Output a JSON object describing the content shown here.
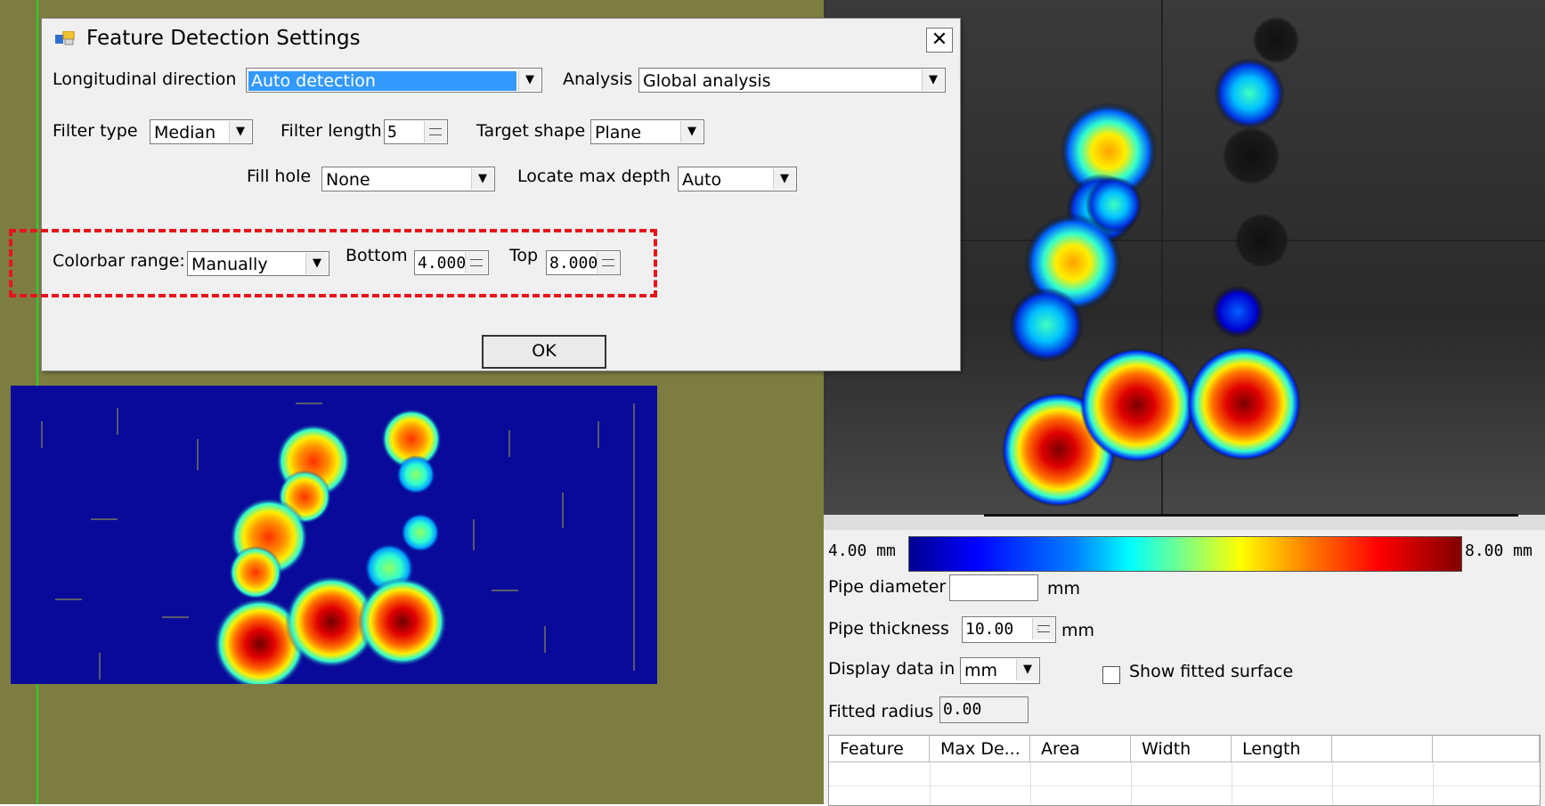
{
  "dialog": {
    "title": "Feature Detection Settings",
    "close_symbol": "✕",
    "longitudinal_direction": {
      "label": "Longitudinal direction",
      "value": "Auto detection"
    },
    "analysis": {
      "label": "Analysis",
      "value": "Global analysis"
    },
    "filter_type": {
      "label": "Filter type",
      "value": "Median"
    },
    "filter_length": {
      "label": "Filter length",
      "value": "5"
    },
    "target_shape": {
      "label": "Target shape",
      "value": "Plane"
    },
    "fill_hole": {
      "label": "Fill hole",
      "value": "None"
    },
    "locate_max_depth": {
      "label": "Locate max depth",
      "value": "Auto"
    },
    "colorbar_range": {
      "label": "Colorbar range:",
      "value": "Manually"
    },
    "bottom": {
      "label": "Bottom",
      "value": "4.000"
    },
    "top": {
      "label": "Top",
      "value": "8.000"
    },
    "ok_label": "OK",
    "combo_arrow": "▼"
  },
  "colorbar": {
    "min_label": "4.00 mm",
    "max_label": "8.00 mm",
    "colors": [
      "#00008f",
      "#0000ff",
      "#00ffff",
      "#ffff00",
      "#ff0000",
      "#800000"
    ]
  },
  "pipe": {
    "diameter_label": "Pipe diameter",
    "diameter_value": "",
    "diameter_unit": "mm",
    "thickness_label": "Pipe thickness",
    "thickness_value": "10.00",
    "thickness_unit": "mm",
    "display_label": "Display data in",
    "display_value": "mm",
    "show_fitted_label": "Show fitted surface",
    "fitted_radius_label": "Fitted radius",
    "fitted_radius_value": "0.00"
  },
  "table": {
    "columns": [
      "Feature",
      "Max De...",
      "Area",
      "Width",
      "Length",
      "",
      ""
    ]
  },
  "accent_colors": {
    "highlight": "#e8141c",
    "selection": "#3399ff",
    "workspace": "#7d7d42"
  }
}
